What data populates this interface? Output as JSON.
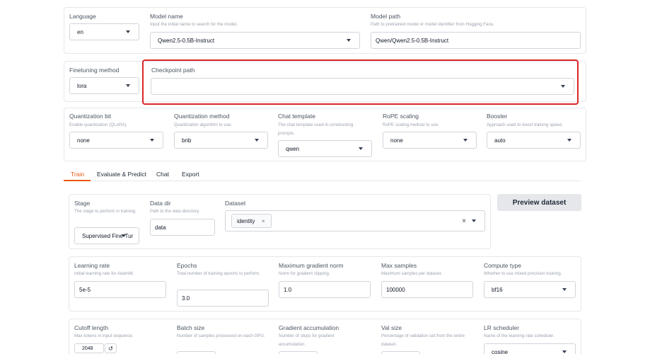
{
  "top_row": {
    "language": {
      "label": "Language",
      "value": "en"
    },
    "model_name": {
      "label": "Model name",
      "info": "Input the initial name to search for the model.",
      "value": "Qwen2.5-0.5B-Instruct"
    },
    "model_path": {
      "label": "Model path",
      "info": "Path to pretrained model or model identifier from Hugging Face.",
      "value": "Qwen/Qwen2.5-0.5B-Instruct"
    }
  },
  "second_row": {
    "finetuning_method": {
      "label": "Finetuning method",
      "value": "lora"
    },
    "checkpoint_path": {
      "label": "Checkpoint path",
      "value": ""
    }
  },
  "third_row": {
    "quantization_bit": {
      "label": "Quantization bit",
      "info": "Enable quantization (QLoRA).",
      "value": "none"
    },
    "quantization_method": {
      "label": "Quantization method",
      "info": "Quantization algorithm to use.",
      "value": "bnb"
    },
    "chat_template": {
      "label": "Chat template",
      "info": "The chat template used in constructing prompts.",
      "value": "qwen"
    },
    "rope_scaling": {
      "label": "RoPE scaling",
      "info": "RoPE scaling method to use.",
      "value": "none"
    },
    "booster": {
      "label": "Booster",
      "info": "Approach used to boost training speed.",
      "value": "auto"
    }
  },
  "tabs": [
    "Train",
    "Evaluate & Predict",
    "Chat",
    "Export"
  ],
  "train": {
    "stage": {
      "label": "Stage",
      "info": "The stage to perform in training.",
      "value": "Supervised Fine-Tur"
    },
    "data_dir": {
      "label": "Data dir",
      "info": "Path to the data directory.",
      "value": "data"
    },
    "dataset": {
      "label": "Dataset",
      "chip": "identity",
      "chip_remove": "×",
      "clear": "×"
    },
    "preview_button": "Preview dataset",
    "learning_rate": {
      "label": "Learning rate",
      "info": "Initial learning rate for AdamW.",
      "value": "5e-5"
    },
    "epochs": {
      "label": "Epochs",
      "info": "Total number of training epochs to perform.",
      "value": "3.0"
    },
    "max_grad_norm": {
      "label": "Maximum gradient norm",
      "info": "Norm for gradient clipping.",
      "value": "1.0"
    },
    "max_samples": {
      "label": "Max samples",
      "info": "Maximum samples per dataset.",
      "value": "100000"
    },
    "compute_type": {
      "label": "Compute type",
      "info": "Whether to use mixed precision training.",
      "value": "bf16"
    },
    "cutoff_length": {
      "label": "Cutoff length",
      "info": "Max tokens in input sequence.",
      "value": "2048",
      "reset": "↺"
    },
    "batch_size": {
      "label": "Batch size",
      "info": "Number of samples processed on each GPU."
    },
    "grad_accum": {
      "label": "Gradient accumulation",
      "info": "Number of steps for gradient accumulation."
    },
    "val_size": {
      "label": "Val size",
      "info": "Percentage of validation set from the entire dataset."
    },
    "lr_scheduler": {
      "label": "LR scheduler",
      "info": "Name of the learning rate scheduler.",
      "value": "cosine"
    }
  }
}
